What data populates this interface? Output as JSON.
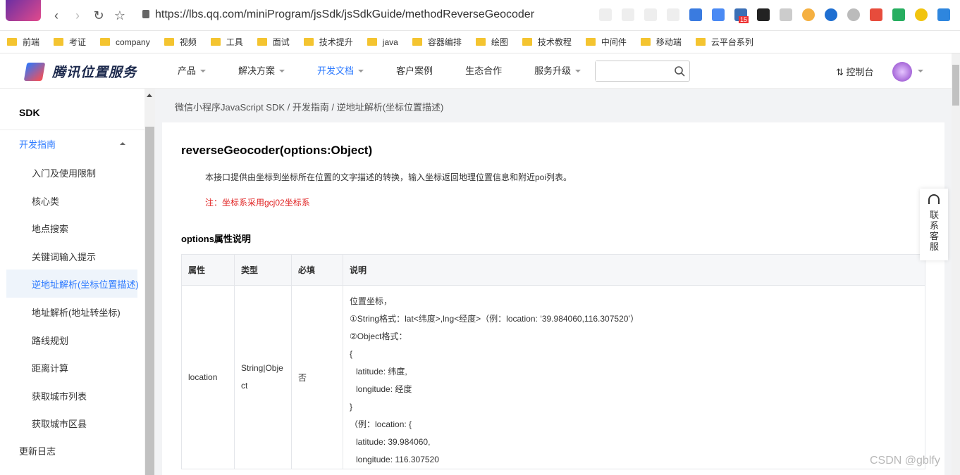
{
  "browser": {
    "url": "https://lbs.qq.com/miniProgram/jsSdk/jsSdkGuide/methodReverseGeocoder",
    "ext_badge": "15"
  },
  "bookmarks": [
    "前端",
    "考证",
    "company",
    "视频",
    "工具",
    "面试",
    "技术提升",
    "java",
    "容器编排",
    "绘图",
    "技术教程",
    "中间件",
    "移动端",
    "云平台系列"
  ],
  "header": {
    "logo": "腾讯位置服务",
    "nav": [
      {
        "label": "产品",
        "caret": true
      },
      {
        "label": "解决方案",
        "caret": true
      },
      {
        "label": "开发文档",
        "caret": true
      },
      {
        "label": "客户案例",
        "caret": false
      },
      {
        "label": "生态合作",
        "caret": false
      },
      {
        "label": "服务升级",
        "caret": true
      }
    ],
    "search_placeholder": "",
    "console": "控制台"
  },
  "sidebar": {
    "title": "SDK",
    "section": "开发指南",
    "items": [
      "入门及使用限制",
      "核心类",
      "地点搜索",
      "关键词输入提示",
      "逆地址解析(坐标位置描述)",
      "地址解析(地址转坐标)",
      "路线规划",
      "距离计算",
      "获取城市列表",
      "获取城市区县"
    ],
    "changelog": "更新日志"
  },
  "content": {
    "breadcrumb": "微信小程序JavaScript SDK / 开发指南 / 逆地址解析(坐标位置描述)",
    "title": "reverseGeocoder(options:Object)",
    "description": "本接口提供由坐标到坐标所在位置的文字描述的转换，输入坐标返回地理位置信息和附近poi列表。",
    "note": "注：坐标系采用gcj02坐标系",
    "section": "options属性说明",
    "table": {
      "headers": [
        "属性",
        "类型",
        "必填",
        "说明"
      ],
      "row": {
        "name": "location",
        "type": "String|Object",
        "required": "否",
        "desc": [
          "位置坐标，",
          "①String格式：lat<纬度>,lng<经度>（例：location: ‘39.984060,116.307520’）",
          "②Object格式：",
          "{",
          "  latitude: 纬度,",
          "  longitude: 经度",
          "}",
          "（例：location: {",
          "  latitude: 39.984060,",
          "  longitude: 116.307520"
        ]
      }
    }
  },
  "service": "联系客服",
  "watermark": "CSDN @gblfy"
}
